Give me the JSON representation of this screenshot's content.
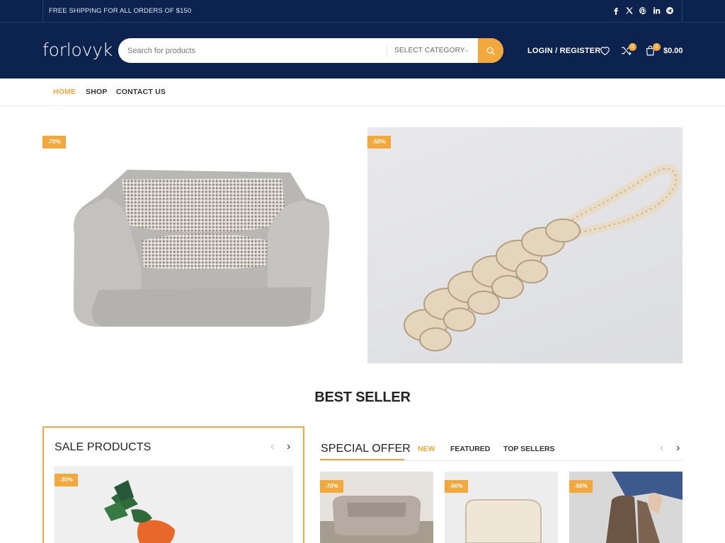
{
  "topbar": {
    "promo": "FREE SHIPPING FOR ALL ORDERS OF $150",
    "socials": [
      "facebook-icon",
      "x-icon",
      "pinterest-icon",
      "linkedin-icon",
      "telegram-icon"
    ]
  },
  "header": {
    "logo": "forlovyk",
    "search": {
      "placeholder": "Search for products",
      "category": "SELECT CATEGORY"
    },
    "login_label": "LOGIN / REGISTER",
    "compare_count": "0",
    "cart_count": "0",
    "cart_total": "$0.00"
  },
  "nav": {
    "items": [
      "HOME",
      "SHOP",
      "CONTACT US"
    ],
    "active": "HOME"
  },
  "hero": [
    {
      "badge": "-70%",
      "image": "pet-bed"
    },
    {
      "badge": "-50%",
      "image": "rope-toy"
    }
  ],
  "best_seller": {
    "title": "BEST SELLER",
    "sale_products": {
      "title": "SALE PRODUCTS",
      "badge": "-30%"
    },
    "special_offer": {
      "title": "SPECIAL OFFER",
      "tabs": [
        "NEW",
        "FEATURED",
        "TOP SELLERS"
      ],
      "active_tab": "NEW",
      "products": [
        {
          "badge": "-70%",
          "image": "pet-bed"
        },
        {
          "badge": "-60%",
          "image": "pillow"
        },
        {
          "badge": "-50%",
          "image": "socks"
        }
      ]
    }
  },
  "colors": {
    "navy": "#0c2350",
    "accent": "#f3a83b"
  }
}
